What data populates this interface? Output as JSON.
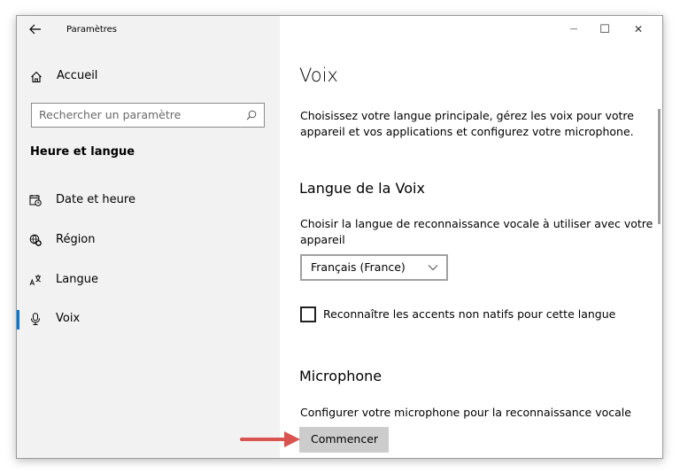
{
  "window": {
    "title": "Paramètres",
    "minimize_glyph": "—",
    "maximize_glyph": "☐",
    "close_glyph": "✕"
  },
  "sidebar": {
    "home_label": "Accueil",
    "search_placeholder": "Rechercher un paramètre",
    "section_title": "Heure et langue",
    "items": [
      {
        "label": "Date et heure",
        "icon": "calendar-clock-icon"
      },
      {
        "label": "Région",
        "icon": "globe-gear-icon"
      },
      {
        "label": "Langue",
        "icon": "language-icon"
      },
      {
        "label": "Voix",
        "icon": "microphone-icon",
        "active": true
      }
    ],
    "accent_color": "#0078d7"
  },
  "main": {
    "page_title": "Voix",
    "intro": [
      "Choisissez votre langue principale, gérez les voix pour votre",
      "appareil et vos applications et configurez votre microphone."
    ],
    "voice_language": {
      "heading": "Langue de la Voix",
      "description": [
        "Choisir la langue de reconnaissance vocale à utiliser avec votre",
        "appareil"
      ],
      "selected_option": "Français (France)",
      "checkbox_label": "Reconnaître les accents non natifs pour cette langue",
      "checkbox_checked": false
    },
    "microphone": {
      "heading": "Microphone",
      "description": "Configurer votre microphone pour la reconnaissance vocale",
      "button_label": "Commencer"
    }
  },
  "annotation": {
    "arrow_color": "#d9534f"
  }
}
